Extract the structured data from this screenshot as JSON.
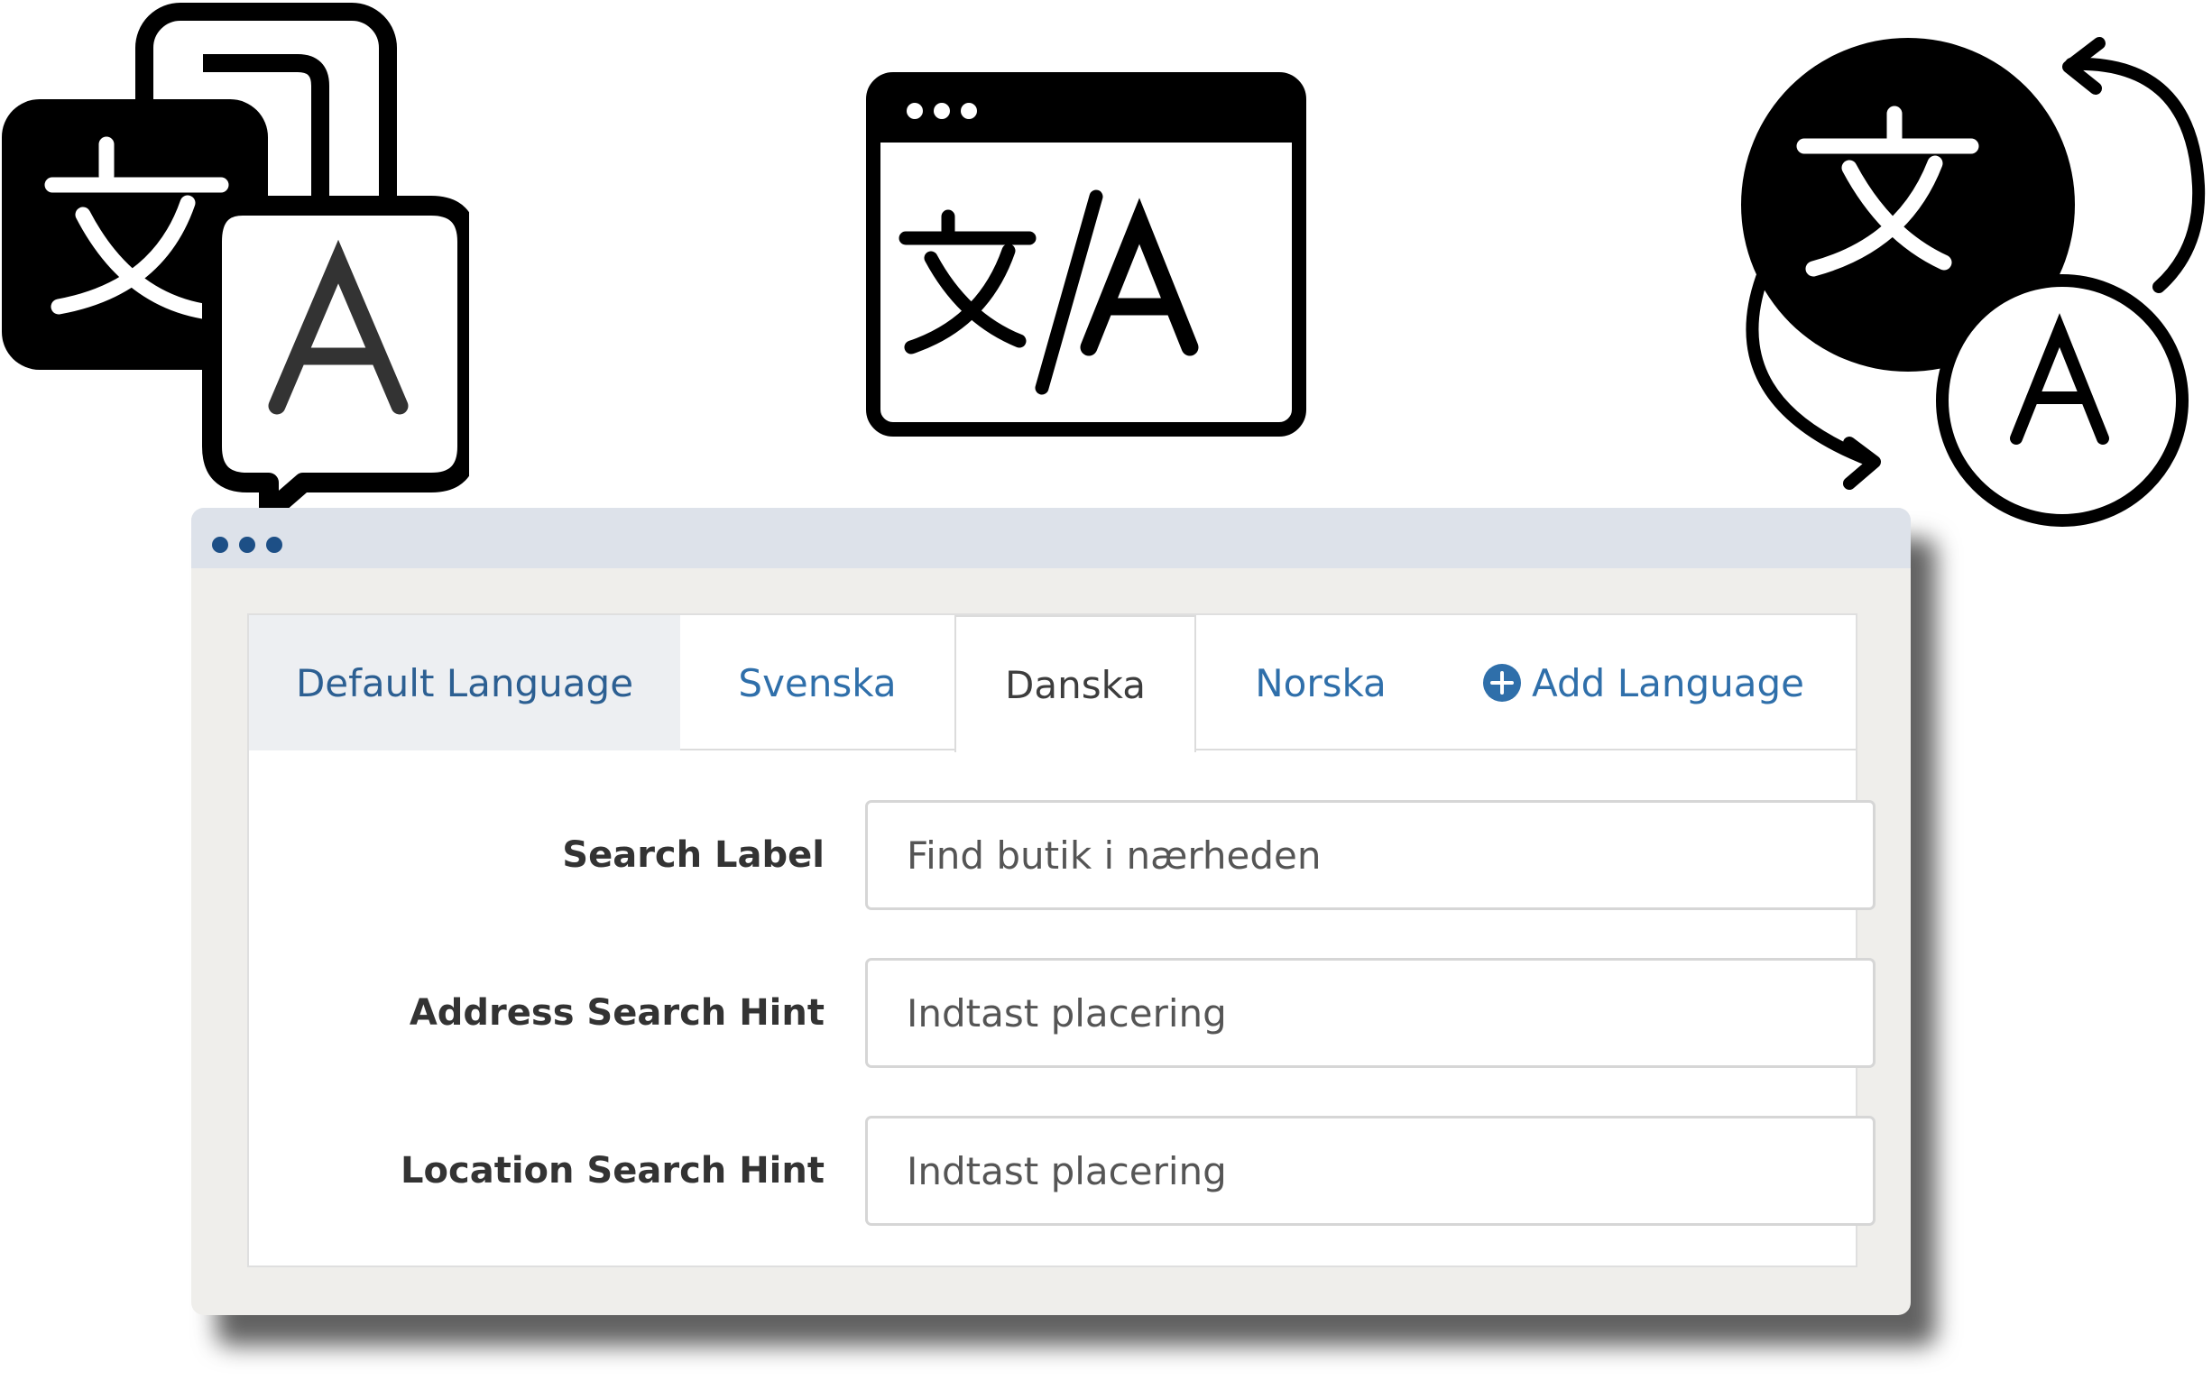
{
  "icons": [
    "translate-bubbles-icon",
    "browser-translate-icon",
    "translate-cycle-icon",
    "add-circle-icon"
  ],
  "colors": {
    "tab_link": "#2f6faa",
    "accent_dot": "#1d4f86",
    "titlebar": "#dde2ea",
    "window_bg": "#efeeeb"
  },
  "tabs": {
    "default": "Default Language",
    "svenska": "Svenska",
    "danska": "Danska",
    "norska": "Norska",
    "add": "Add Language",
    "active": "Danska"
  },
  "fields": {
    "search_label": {
      "label": "Search Label",
      "value": "Find butik i nærheden"
    },
    "address_hint": {
      "label": "Address Search Hint",
      "value": "Indtast placering"
    },
    "location_hint": {
      "label": "Location Search Hint",
      "value": "Indtast placering"
    }
  }
}
